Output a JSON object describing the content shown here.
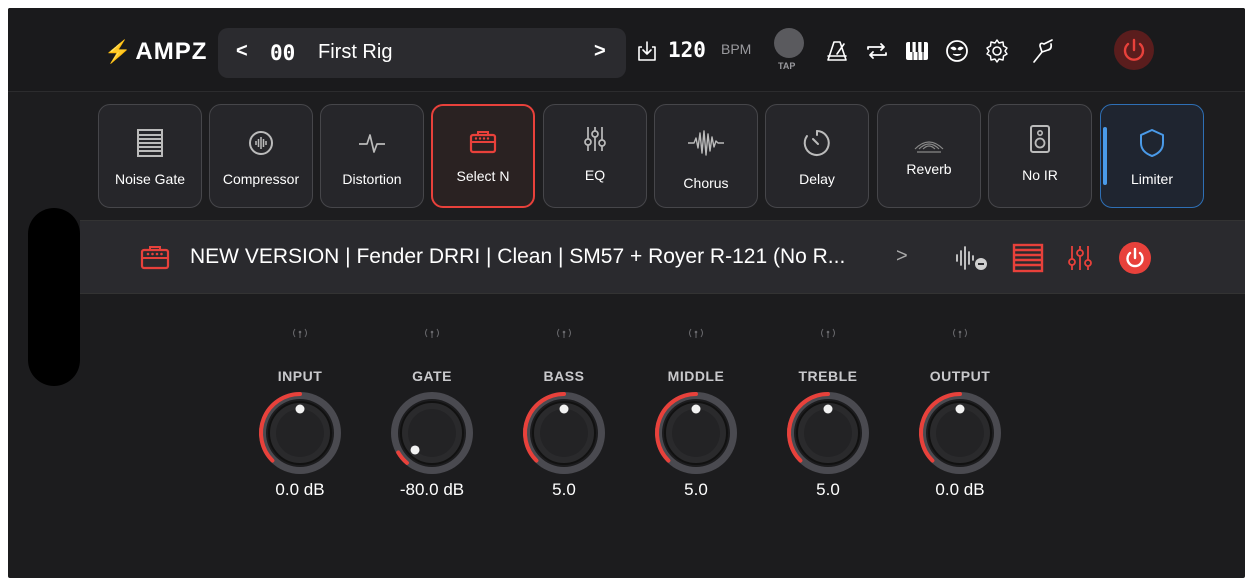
{
  "app": {
    "logo_bolt": "⚡",
    "logo_text": "AMPZ"
  },
  "rig": {
    "prev": "<",
    "number": "00",
    "name": "First Rig",
    "next": ">"
  },
  "tempo": {
    "value": "120",
    "unit": "BPM",
    "tap_label": "TAP"
  },
  "toolbar_icons": [
    "download-icon",
    "metronome-icon",
    "loop-icon",
    "piano-icon",
    "mask-icon",
    "gear-icon",
    "tuner-icon",
    "power-icon"
  ],
  "effects": [
    {
      "label": "Noise Gate",
      "icon": "noise-gate-icon"
    },
    {
      "label": "Compressor",
      "icon": "compressor-icon"
    },
    {
      "label": "Distortion",
      "icon": "distortion-icon"
    },
    {
      "label": "Select N",
      "icon": "amp-icon",
      "selected": true
    },
    {
      "label": "EQ",
      "icon": "eq-sliders-icon"
    },
    {
      "label": "Chorus",
      "icon": "chorus-wave-icon"
    },
    {
      "label": "Delay",
      "icon": "delay-timer-icon"
    },
    {
      "label": "Reverb",
      "icon": "reverb-icon"
    },
    {
      "label": "No IR",
      "icon": "speaker-icon"
    },
    {
      "label": "Limiter",
      "icon": "shield-icon",
      "active": true
    }
  ],
  "amp": {
    "title": "NEW VERSION | Fender DRRI | Clean | SM57 + Royer R-121 (No R...",
    "chevron": ">"
  },
  "knobs": [
    {
      "label": "INPUT",
      "value": "0.0 dB",
      "level": 0.5
    },
    {
      "label": "GATE",
      "value": "-80.0 dB",
      "level": 0.0
    },
    {
      "label": "BASS",
      "value": "5.0",
      "level": 0.5
    },
    {
      "label": "MIDDLE",
      "value": "5.0",
      "level": 0.5
    },
    {
      "label": "TREBLE",
      "value": "5.0",
      "level": 0.5
    },
    {
      "label": "OUTPUT",
      "value": "0.0 dB",
      "level": 0.5
    }
  ],
  "colors": {
    "accent_red": "#e8413b",
    "accent_blue": "#4a9ae8",
    "background": "#1c1c1e"
  }
}
